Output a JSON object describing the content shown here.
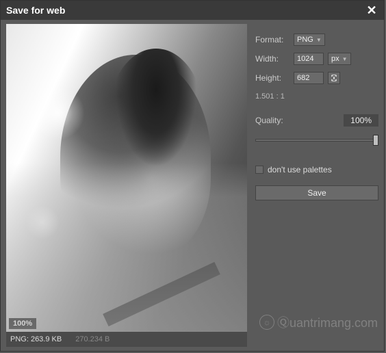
{
  "titlebar": {
    "title": "Save for web"
  },
  "preview": {
    "zoom_badge": "100%"
  },
  "status": {
    "primary": "PNG: 263.9 KB",
    "secondary": "270.234 B"
  },
  "format": {
    "label": "Format:",
    "selected": "PNG"
  },
  "width": {
    "label": "Width:",
    "value": "1024",
    "unit_selected": "px"
  },
  "height": {
    "label": "Height:",
    "value": "682"
  },
  "aspect_ratio": "1.501 : 1",
  "quality": {
    "label": "Quality:",
    "value": "100%"
  },
  "palettes": {
    "label": "don't use palettes",
    "checked": false
  },
  "save_button": "Save",
  "watermark": "uantrimang.com"
}
